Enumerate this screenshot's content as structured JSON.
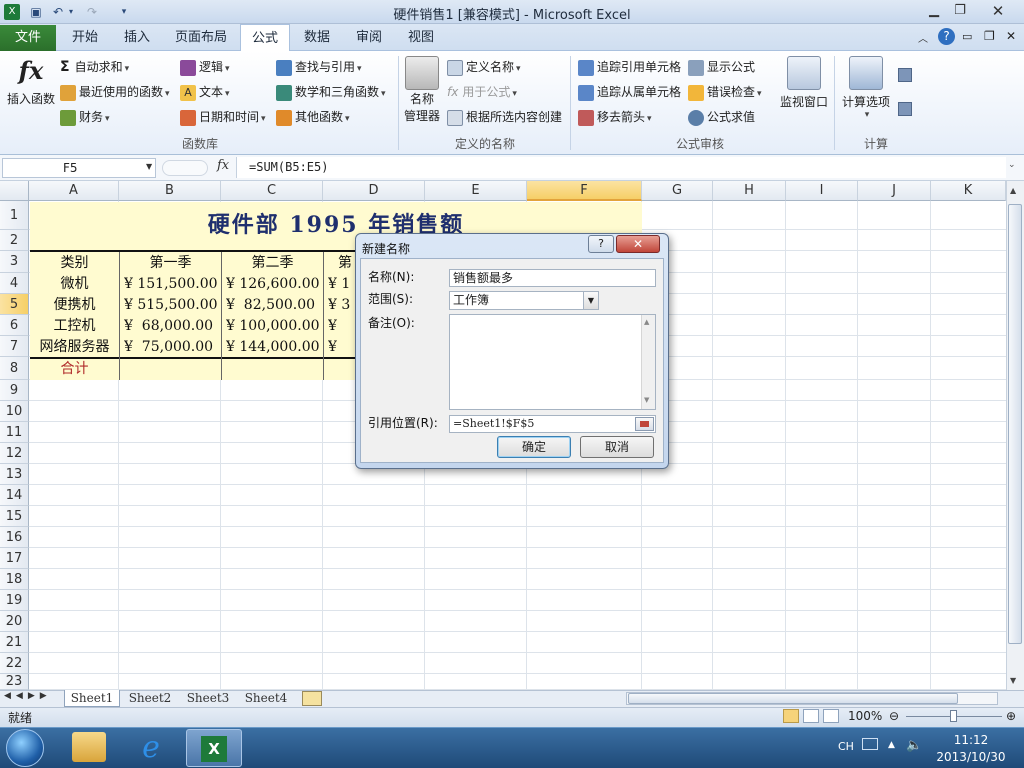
{
  "window": {
    "title": "硬件销售1 [兼容模式] - Microsoft Excel"
  },
  "ribbon": {
    "tabs": [
      {
        "label": "文件",
        "active": false
      },
      {
        "label": "开始",
        "active": false
      },
      {
        "label": "插入",
        "active": false
      },
      {
        "label": "页面布局",
        "active": false
      },
      {
        "label": "公式",
        "active": true
      },
      {
        "label": "数据",
        "active": false
      },
      {
        "label": "审阅",
        "active": false
      },
      {
        "label": "视图",
        "active": false
      }
    ],
    "insert_function": "插入函数",
    "funclib": {
      "autosum": "自动求和",
      "recent": "最近使用的函数",
      "financial": "财务",
      "logical": "逻辑",
      "text": "文本",
      "datetime": "日期和时间",
      "lookup": "查找与引用",
      "math": "数学和三角函数",
      "more": "其他函数",
      "group": "函数库"
    },
    "names": {
      "manager_top": "名称",
      "manager_bottom": "管理器",
      "define": "定义名称",
      "use_in": "用于公式",
      "create_from": "根据所选内容创建",
      "group": "定义的名称"
    },
    "audit": {
      "trace_prec": "追踪引用单元格",
      "trace_dep": "追踪从属单元格",
      "remove_arrows": "移去箭头",
      "show_formulas": "显示公式",
      "error_check": "错误检查",
      "evaluate": "公式求值",
      "watch": "监视窗口",
      "group": "公式审核"
    },
    "calc": {
      "options": "计算选项",
      "group": "计算"
    }
  },
  "formula_bar": {
    "name_box": "F5",
    "fx": "fx",
    "formula": "=SUM(B5:E5)"
  },
  "columns": [
    "A",
    "B",
    "C",
    "D",
    "E",
    "F",
    "G",
    "H",
    "I",
    "J",
    "K"
  ],
  "selected_column": "F",
  "selected_row": "5",
  "rows": [
    "1",
    "2",
    "3",
    "4",
    "5",
    "6",
    "7",
    "8",
    "9",
    "10",
    "11",
    "12",
    "13",
    "14",
    "15",
    "16",
    "17",
    "18",
    "19",
    "20",
    "21",
    "22",
    "23"
  ],
  "sheet": {
    "title": "硬件部 1995 年销售额",
    "headers": [
      "类别",
      "第一季",
      "第二季",
      "第"
    ],
    "data": [
      {
        "category": "微机",
        "q1": "¥ 151,500.00",
        "q2": "¥ 126,600.00",
        "q3": "¥ 1"
      },
      {
        "category": "便携机",
        "q1": "¥ 515,500.00",
        "q2": "¥  82,500.00",
        "q3": "¥ 3"
      },
      {
        "category": "工控机",
        "q1": "¥  68,000.00",
        "q2": "¥ 100,000.00",
        "q3": "¥"
      },
      {
        "category": "网络服务器",
        "q1": "¥  75,000.00",
        "q2": "¥ 144,000.00",
        "q3": "¥"
      }
    ],
    "total_label": "合计"
  },
  "dialog": {
    "title": "新建名称",
    "help": "?",
    "name_label": "名称(N):",
    "name_value": "销售额最多",
    "scope_label": "范围(S):",
    "scope_value": "工作簿",
    "comment_label": "备注(O):",
    "refers_label": "引用位置(R):",
    "refers_value": "=Sheet1!$F$5",
    "ok": "确定",
    "cancel": "取消"
  },
  "sheet_tabs": [
    "Sheet1",
    "Sheet2",
    "Sheet3",
    "Sheet4"
  ],
  "status": {
    "ready": "就绪",
    "zoom": "100%"
  },
  "taskbar": {
    "lang": "CH",
    "time": "11:12",
    "date": "2013/10/30"
  }
}
